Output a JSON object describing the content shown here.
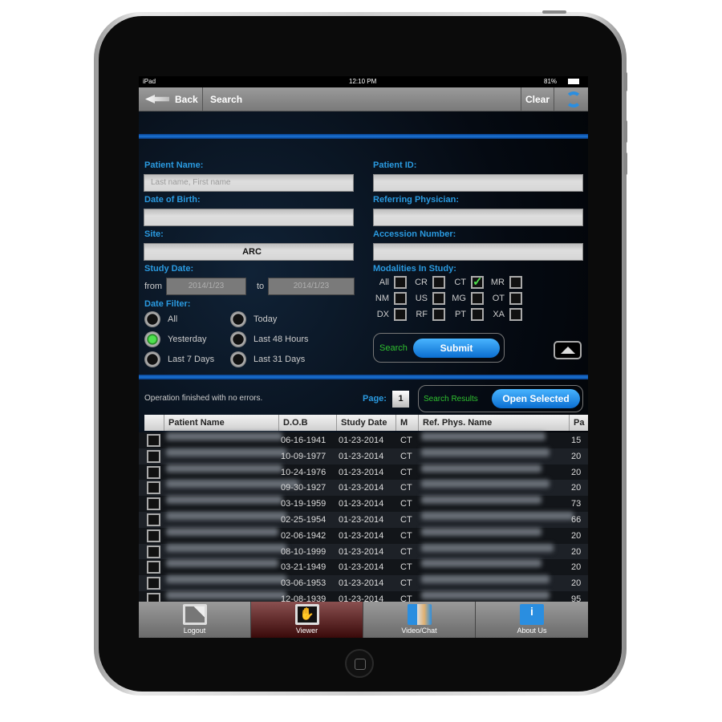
{
  "status_bar": {
    "device": "iPad",
    "time": "12:10 PM",
    "battery": "81%"
  },
  "nav": {
    "back": "Back",
    "title": "Search",
    "clear": "Clear"
  },
  "form": {
    "patient_name": {
      "label": "Patient Name:",
      "placeholder": "Last name, First name",
      "value": ""
    },
    "patient_id": {
      "label": "Patient ID:",
      "value": ""
    },
    "dob": {
      "label": "Date of Birth:",
      "value": ""
    },
    "referring": {
      "label": "Referring Physician:",
      "value": ""
    },
    "site": {
      "label": "Site:",
      "value": "ARC"
    },
    "accession": {
      "label": "Accession Number:",
      "value": ""
    },
    "study_date": {
      "label": "Study Date:",
      "from_label": "from",
      "from": "2014/1/23",
      "to_label": "to",
      "to": "2014/1/23"
    },
    "date_filter": {
      "label": "Date Filter:",
      "options": [
        {
          "label": "All",
          "selected": false
        },
        {
          "label": "Today",
          "selected": false
        },
        {
          "label": "Yesterday",
          "selected": true
        },
        {
          "label": "Last 48 Hours",
          "selected": false
        },
        {
          "label": "Last 7 Days",
          "selected": false
        },
        {
          "label": "Last 31 Days",
          "selected": false
        }
      ]
    },
    "modalities": {
      "label": "Modalities In Study:",
      "items": [
        {
          "label": "All",
          "checked": false
        },
        {
          "label": "CR",
          "checked": false
        },
        {
          "label": "CT",
          "checked": true
        },
        {
          "label": "MR",
          "checked": false
        },
        {
          "label": "NM",
          "checked": false
        },
        {
          "label": "US",
          "checked": false
        },
        {
          "label": "MG",
          "checked": false
        },
        {
          "label": "OT",
          "checked": false
        },
        {
          "label": "DX",
          "checked": false
        },
        {
          "label": "RF",
          "checked": false
        },
        {
          "label": "PT",
          "checked": false
        },
        {
          "label": "XA",
          "checked": false
        }
      ]
    },
    "search_label": "Search",
    "submit": "Submit"
  },
  "results": {
    "status": "Operation finished with no errors.",
    "page_label": "Page:",
    "page": "1",
    "results_label": "Search Results",
    "open_selected": "Open Selected",
    "columns": [
      "Patient Name",
      "D.O.B",
      "Study Date",
      "M",
      "Ref. Phys. Name",
      "Pa"
    ],
    "rows": [
      {
        "dob": "06-16-1941",
        "study": "01-23-2014",
        "m": "CT",
        "pa": "15"
      },
      {
        "dob": "10-09-1977",
        "study": "01-23-2014",
        "m": "CT",
        "pa": "20"
      },
      {
        "dob": "10-24-1976",
        "study": "01-23-2014",
        "m": "CT",
        "pa": "20"
      },
      {
        "dob": "09-30-1927",
        "study": "01-23-2014",
        "m": "CT",
        "pa": "20"
      },
      {
        "dob": "03-19-1959",
        "study": "01-23-2014",
        "m": "CT",
        "pa": "73"
      },
      {
        "dob": "02-25-1954",
        "study": "01-23-2014",
        "m": "CT",
        "pa": "66"
      },
      {
        "dob": "02-06-1942",
        "study": "01-23-2014",
        "m": "CT",
        "pa": "20"
      },
      {
        "dob": "08-10-1999",
        "study": "01-23-2014",
        "m": "CT",
        "pa": "20"
      },
      {
        "dob": "03-21-1949",
        "study": "01-23-2014",
        "m": "CT",
        "pa": "20"
      },
      {
        "dob": "03-06-1953",
        "study": "01-23-2014",
        "m": "CT",
        "pa": "20"
      },
      {
        "dob": "12-08-1939",
        "study": "01-23-2014",
        "m": "CT",
        "pa": "95"
      }
    ]
  },
  "tabs": [
    {
      "label": "Logout",
      "icon": "logout-icon",
      "active": false
    },
    {
      "label": "Viewer",
      "icon": "hand-icon",
      "active": true
    },
    {
      "label": "Video/Chat",
      "icon": "video-chat-icon",
      "active": false
    },
    {
      "label": "About Us",
      "icon": "info-icon",
      "active": false
    }
  ],
  "colors": {
    "accent": "#2a9ae0",
    "active_tab": "#5a1a1a",
    "search_green": "#2fc02f"
  }
}
